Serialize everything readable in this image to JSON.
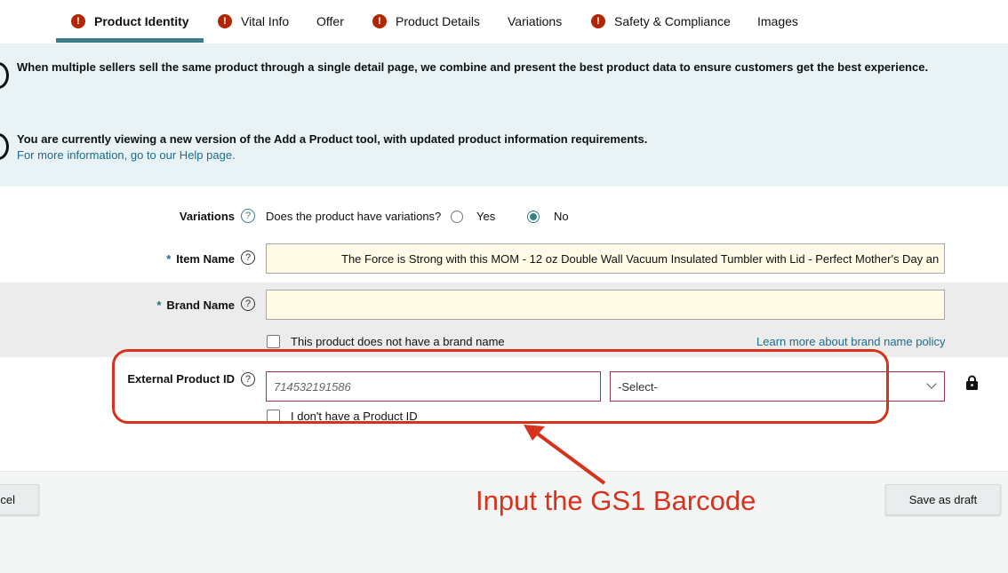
{
  "tabs": [
    {
      "label": "Product Identity",
      "warning": true,
      "active": true
    },
    {
      "label": "Vital Info",
      "warning": true,
      "active": false
    },
    {
      "label": "Offer",
      "warning": false,
      "active": false
    },
    {
      "label": "Product Details",
      "warning": true,
      "active": false
    },
    {
      "label": "Variations",
      "warning": false,
      "active": false
    },
    {
      "label": "Safety & Compliance",
      "warning": true,
      "active": false
    },
    {
      "label": "Images",
      "warning": false,
      "active": false
    }
  ],
  "warning_glyph": "!",
  "banners": {
    "info1": "When multiple sellers sell the same product through a single detail page, we combine and present the best product data to ensure customers get the best experience.",
    "info2": "You are currently viewing a new version of the Add a Product tool, with updated product information requirements.",
    "info2_link": "For more information, go to our Help page."
  },
  "form": {
    "variations": {
      "label": "Variations",
      "question": "Does the product have variations?",
      "yes_label": "Yes",
      "no_label": "No",
      "selected": "No"
    },
    "item_name": {
      "required_mark": "*",
      "label": "Item Name",
      "value": "The Force is Strong with this MOM - 12 oz Double Wall Vacuum Insulated Tumbler with Lid - Perfect Mother's Day an"
    },
    "brand_name": {
      "required_mark": "*",
      "label": "Brand Name",
      "value": "",
      "no_brand_label": "This product does not have a brand name",
      "policy_link": "Learn more about brand name policy"
    },
    "external_product_id": {
      "label": "External Product ID",
      "placeholder": "714532191586",
      "select_value": "-Select-",
      "no_id_label": "I don't have a Product ID"
    },
    "help_glyph": "?"
  },
  "footer": {
    "cancel_label": "cel",
    "save_draft_label": "Save as draft"
  },
  "annotation": {
    "text": "Input the GS1 Barcode",
    "color": "#d5331b"
  },
  "colors": {
    "accent": "#3d7d86",
    "warning": "#b12704",
    "banner_bg": "#e9f3f5",
    "input_bg": "#fffbe6"
  },
  "icons": [
    "warning-icon",
    "help-icon",
    "lock-icon",
    "chevron-down-icon",
    "info-icon"
  ]
}
